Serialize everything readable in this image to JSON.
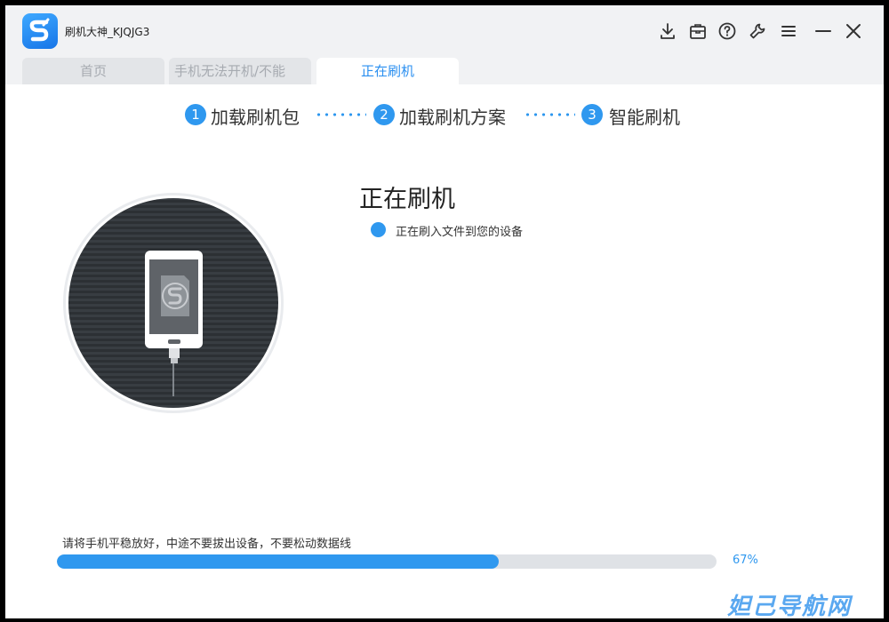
{
  "app": {
    "title": "刷机大神_KJQJG3"
  },
  "title_buttons": [
    {
      "name": "download-icon"
    },
    {
      "name": "toolbox-icon"
    },
    {
      "name": "help-icon"
    },
    {
      "name": "wrench-icon"
    },
    {
      "name": "menu-icon"
    },
    {
      "name": "minimize-icon"
    },
    {
      "name": "close-icon"
    }
  ],
  "tabs": [
    {
      "label": "首页",
      "active": false
    },
    {
      "label": "手机无法开机/不能",
      "active": false
    },
    {
      "label": "正在刷机",
      "active": true
    }
  ],
  "steps": [
    {
      "num": "1",
      "label": "加载刷机包"
    },
    {
      "num": "2",
      "label": "加载刷机方案"
    },
    {
      "num": "3",
      "label": "智能刷机"
    }
  ],
  "flash": {
    "title": "正在刷机",
    "status": "正在刷入文件到您的设备"
  },
  "progress": {
    "hint": "请将手机平稳放好，中途不要拔出设备，不要松动数据线",
    "percent_label": "67%",
    "percent": 67
  },
  "watermark": "妲己导航网",
  "colors": {
    "accent": "#2f98ef",
    "tab_active_text": "#2a8ff0",
    "titlebar_bg": "#f1f2f4"
  }
}
